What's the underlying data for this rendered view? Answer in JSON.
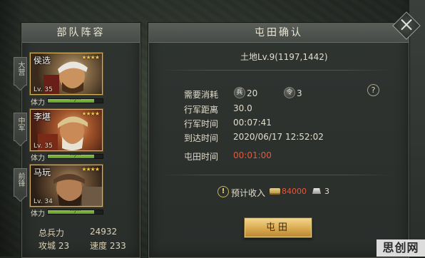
{
  "left_panel": {
    "title": "部队阵容",
    "slots": [
      {
        "position": "大营",
        "name": "侯选",
        "stars": "★★★★",
        "level": "Lv. 35",
        "hp_label": "体力",
        "hp_fraction": 0.85,
        "hp_text": "···/···"
      },
      {
        "position": "中军",
        "name": "李堪",
        "stars": "★★★★",
        "level": "Lv. 35",
        "hp_label": "体力",
        "hp_fraction": 0.85,
        "hp_text": "···/···"
      },
      {
        "position": "前锋",
        "name": "马玩",
        "stars": "★★★★",
        "level": "Lv. 34",
        "hp_label": "体力",
        "hp_fraction": 0.85,
        "hp_text": "···/···"
      }
    ],
    "stats": {
      "total_troops_label": "总兵力",
      "total_troops_value": "24932",
      "siege_label": "攻城",
      "siege_value": "23",
      "speed_label": "速度",
      "speed_value": "233"
    }
  },
  "right_panel": {
    "title": "屯田确认",
    "land": "土地Lv.9(1197,1442)",
    "cost_label": "需要消耗",
    "cost_1": "20",
    "cost_2": "3",
    "distance_label": "行军距离",
    "distance_value": "30.0",
    "march_time_label": "行军时间",
    "march_time_value": "00:07:41",
    "arrive_label": "到达时间",
    "arrive_value": "2020/06/17 12:52:02",
    "farm_time_label": "屯田时间",
    "farm_time_value": "00:01:00",
    "income_label": "预计收入",
    "income_1": "84000",
    "income_2": "3",
    "button_label": "屯田"
  },
  "watermark": "思创网",
  "icons": {
    "close": "close-icon",
    "help": "help-icon",
    "warning": "warning-icon",
    "cost_1": "troop-token-icon",
    "cost_2": "command-token-icon",
    "income_1": "grain-scroll-icon",
    "income_2": "silver-ingot-icon"
  },
  "colors": {
    "accent_gold": "#d9a94f",
    "alert_red": "#e25a3c",
    "hp_green": "#8fc64a"
  }
}
